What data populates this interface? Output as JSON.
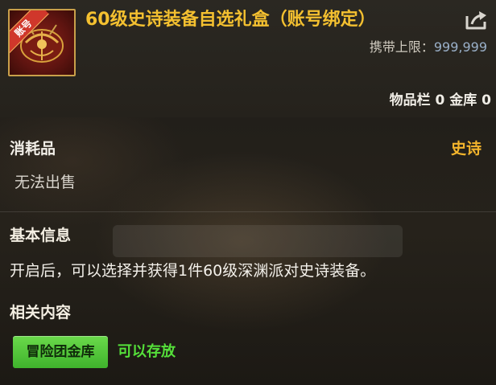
{
  "item": {
    "title": "60级史诗装备自选礼盒（账号绑定）",
    "icon_name": "gift-box-icon",
    "icon_tag": "账号",
    "carry_limit_label": "携带上限：",
    "carry_limit_value": "999,999",
    "storage_text": "物品栏 0 金库 0"
  },
  "meta": {
    "category": "消耗品",
    "rarity": "史诗",
    "sell_status": "无法出售"
  },
  "basic_info": {
    "heading": "基本信息",
    "description": "开启后，可以选择并获得1件60级深渊派对史诗装备。"
  },
  "related": {
    "heading": "相关内容",
    "storage_chip": "冒险团金库",
    "storage_status": "可以存放"
  },
  "colors": {
    "title": "#f4c030",
    "rarity": "#f3b42c",
    "chip": "#4fc136",
    "status_ok": "#55e03a"
  }
}
